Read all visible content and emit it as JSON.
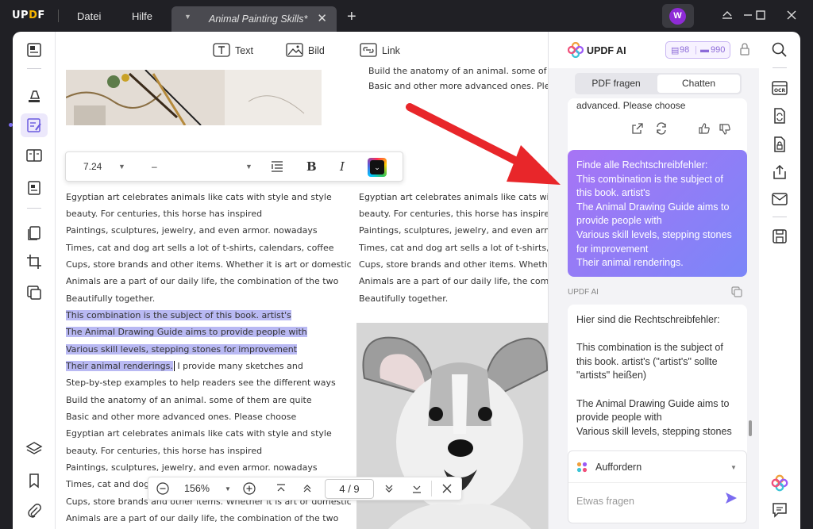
{
  "titlebar": {
    "logo": "UPDF",
    "menu": [
      "Datei",
      "Hilfe"
    ],
    "tab_title": "Animal Painting Skills*",
    "avatar_letter": "W"
  },
  "doc_toolbar": {
    "text_label": "Text",
    "image_label": "Bild",
    "link_label": "Link"
  },
  "format_bar": {
    "font_size": "7.24",
    "font_name": "–",
    "bold": "B",
    "italic": "I"
  },
  "page1_right_lines": [
    "Build the anatomy of an animal. some of them are",
    "Basic and other more advanced ones. Please"
  ],
  "page2_left_lines": [
    "Egyptian art celebrates animals like cats with style and style",
    "beauty. For centuries, this horse has inspired",
    "Paintings, sculptures, jewelry, and even armor. nowadays",
    "Times, cat and dog art sells a lot of t-shirts, calendars, coffee",
    "Cups, store brands and other items. Whether it is art or domestic",
    "Animals are a part of our daily life, the combination of the two",
    "Beautifully together."
  ],
  "page2_highlight_lines": [
    "This combination is the subject of this book. artist's",
    "The Animal Drawing Guide aims to provide people with",
    "Various skill levels, stepping stones for improvement",
    "Their animal renderings."
  ],
  "page2_highlight_tail": "I provide many sketches and",
  "page2_left_lines_b": [
    "Step-by-step examples to help readers see the different ways",
    "Build the anatomy of an animal. some of them are quite",
    "Basic and other more advanced ones. Please choose",
    "Egyptian art celebrates animals like cats with style and style",
    "beauty. For centuries, this horse has inspired",
    "Paintings, sculptures, jewelry, and even armor. nowadays",
    "Times, cat and dog art sells a lot of t-shirts, calendars, coffee",
    "Cups, store brands and other items. Whether it is art or domestic",
    "Animals are a part of our daily life, the combination of the two"
  ],
  "page2_right_lines": [
    "Egyptian art celebrates animals like cats with style and style",
    "beauty. For centuries, this horse has inspired",
    "Paintings, sculptures, jewelry, and even armor. nowadays",
    "Times, cat and dog art sells a lot of t-shirts, calendars, coffee",
    "Cups, store brands and other items. Whether it is art or domestic",
    "Animals are a part of our daily life, the combination of the two",
    "Beautifully together."
  ],
  "navigation": {
    "zoom": "156%",
    "current_page": "4",
    "total_pages": "9"
  },
  "ai_panel": {
    "title": "UPDF AI",
    "quota_a": "98",
    "quota_b": "990",
    "tab_pdf": "PDF fragen",
    "tab_chat": "Chatten",
    "prev_message_tail": "advanced. Please choose",
    "user_message": "Finde alle Rechtschreibfehler:\nThis combination is the subject of this book. artist's\nThe Animal Drawing Guide aims to provide people with\nVarious skill levels, stepping stones for improvement\nTheir animal renderings.",
    "ai_label": "UPDF AI",
    "ai_message": "Hier sind die Rechtschreibfehler:\n\nThis combination is the subject of this book. artist's (\"artist's\" sollte \"artists\" heißen)\n\nThe Animal Drawing Guide aims to provide people with\nVarious skill levels, stepping stones",
    "prompt_selector": "Auffordern",
    "input_placeholder": "Etwas fragen"
  },
  "colors": {
    "accent": "#7b6cf0",
    "arrow": "#e8262a",
    "highlight": "#b9b9f3",
    "bubble_start": "#a774f5",
    "bubble_end": "#7b86f8"
  }
}
